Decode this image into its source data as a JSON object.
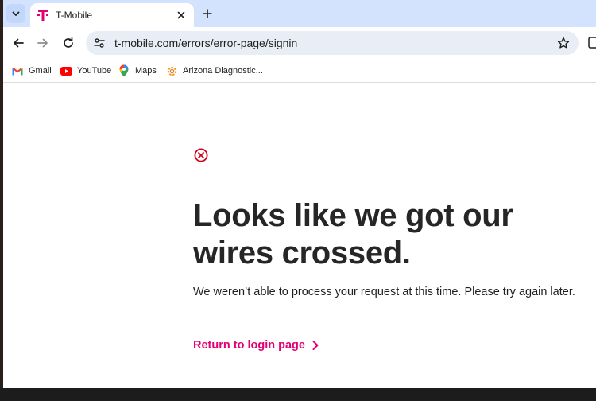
{
  "browser": {
    "tab": {
      "title": "T-Mobile"
    },
    "url": "t-mobile.com/errors/error-page/signin"
  },
  "bookmarks": [
    {
      "label": "Gmail",
      "icon": "gmail-icon"
    },
    {
      "label": "YouTube",
      "icon": "youtube-icon"
    },
    {
      "label": "Maps",
      "icon": "maps-icon"
    },
    {
      "label": "Arizona Diagnostic...",
      "icon": "arizona-diagnostic-icon"
    }
  ],
  "page": {
    "headline": "Looks like we got our wires crossed.",
    "message": "We weren’t able to process your request at this time. Please try again later.",
    "return_link": "Return to login page"
  },
  "colors": {
    "brand_magenta": "#e20074",
    "error_red": "#d0021b",
    "tabstrip": "#d3e3fd",
    "omnibox": "#e9eef6"
  }
}
